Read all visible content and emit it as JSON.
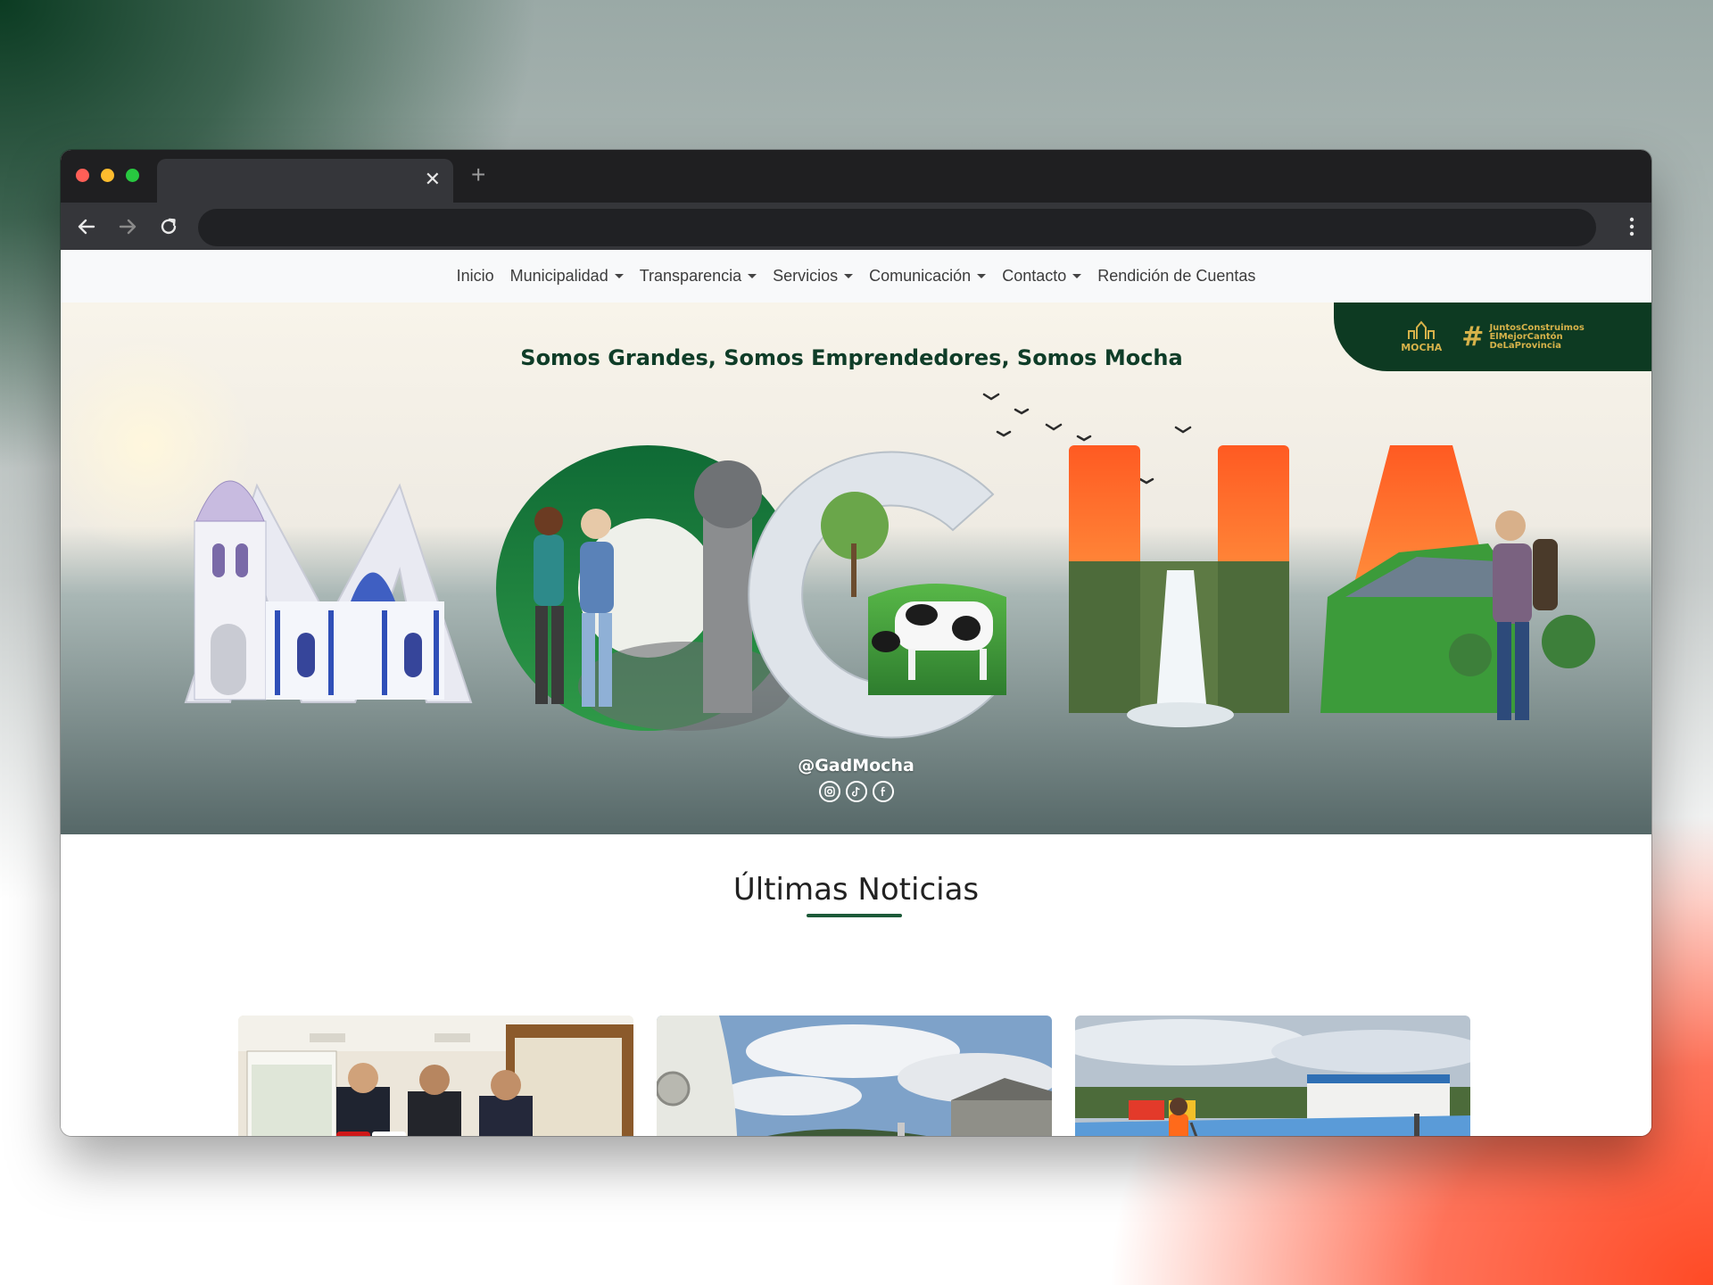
{
  "browser": {
    "tab_title": "",
    "tab_close": "✕",
    "new_tab": "+",
    "address": ""
  },
  "nav": {
    "items": [
      {
        "label": "Inicio",
        "dropdown": false
      },
      {
        "label": "Municipalidad",
        "dropdown": true
      },
      {
        "label": "Transparencia",
        "dropdown": true
      },
      {
        "label": "Servicios",
        "dropdown": true
      },
      {
        "label": "Comunicación",
        "dropdown": true
      },
      {
        "label": "Contacto",
        "dropdown": true
      },
      {
        "label": "Rendición de Cuentas",
        "dropdown": false
      }
    ]
  },
  "hero": {
    "title": "Somos Grandes, Somos Emprendedores, Somos Mocha",
    "big_word": "MOCHA",
    "handle": "@GadMocha",
    "socials": [
      "instagram-icon",
      "tiktok-icon",
      "facebook-icon"
    ],
    "badge": {
      "logo_text": "MOCHA",
      "hashtag_symbol": "#",
      "hashtag": "JuntosConstruimos\nElMejorCantón\nDeLaProvincia"
    }
  },
  "news": {
    "heading": "Últimas Noticias",
    "cards": [
      {
        "image": "officials-signing-photo"
      },
      {
        "image": "monument-landscape-photo"
      },
      {
        "image": "sports-court-photo"
      }
    ]
  },
  "colors": {
    "brand_green": "#0d3a22",
    "accent_gold": "#d6b24a",
    "underline": "#1c5a38"
  }
}
